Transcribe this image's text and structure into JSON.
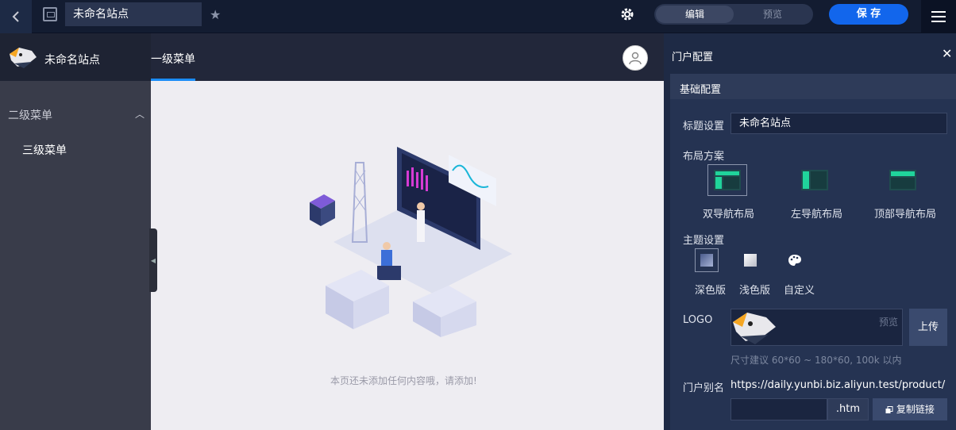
{
  "topbar": {
    "title": "未命名站点",
    "mode_edit": "编辑",
    "mode_preview": "预览",
    "save_label": "保 存"
  },
  "site": {
    "name": "未命名站点",
    "nav_level1": "一级菜单",
    "menu_level2": "二级菜单",
    "menu_level3": "三级菜单",
    "empty_text": "本页还未添加任何内容哦，请添加!"
  },
  "panel": {
    "title": "门户配置",
    "section": "基础配置",
    "title_label": "标题设置",
    "title_value": "未命名站点",
    "layout_label": "布局方案",
    "layouts": [
      "双导航布局",
      "左导航布局",
      "顶部导航布局"
    ],
    "theme_label": "主题设置",
    "themes": [
      "深色版",
      "浅色版",
      "自定义"
    ],
    "logo_label": "LOGO",
    "logo_preview": "预览",
    "upload": "上传",
    "logo_hint": "尺寸建议 60*60 ~ 180*60, 100k 以内",
    "alias_label": "门户别名",
    "alias_url": "https://daily.yunbi.biz.aliyun.test/product/",
    "alias_ext": ".htm",
    "copy_link": "复制链接"
  },
  "colors": {
    "accent": "#1266ec",
    "nav_active": "#1b8cf7",
    "panel_bg": "#1e2a45"
  }
}
